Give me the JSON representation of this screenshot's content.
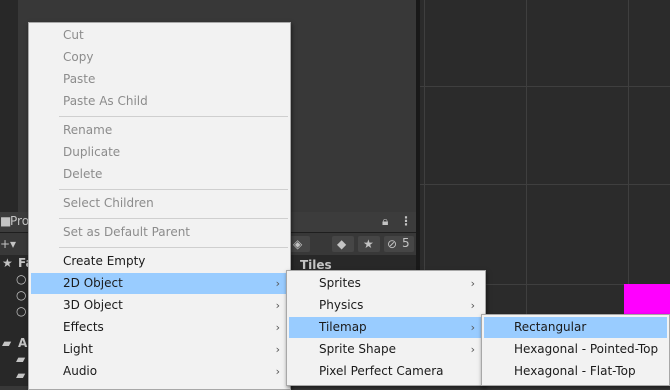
{
  "context_menu": {
    "items": [
      {
        "label": "Cut",
        "enabled": false
      },
      {
        "label": "Copy",
        "enabled": false
      },
      {
        "label": "Paste",
        "enabled": false
      },
      {
        "label": "Paste As Child",
        "enabled": false
      },
      {
        "label": "Rename",
        "enabled": false
      },
      {
        "label": "Duplicate",
        "enabled": false
      },
      {
        "label": "Delete",
        "enabled": false
      },
      {
        "label": "Select Children",
        "enabled": false
      },
      {
        "label": "Set as Default Parent",
        "enabled": false
      },
      {
        "label": "Create Empty",
        "enabled": true
      },
      {
        "label": "2D Object",
        "enabled": true,
        "submenu": true,
        "highlighted": true
      },
      {
        "label": "3D Object",
        "enabled": true,
        "submenu": true
      },
      {
        "label": "Effects",
        "enabled": true,
        "submenu": true
      },
      {
        "label": "Light",
        "enabled": true,
        "submenu": true
      },
      {
        "label": "Audio",
        "enabled": true,
        "submenu": true
      }
    ]
  },
  "submenu_2d_object": {
    "items": [
      {
        "label": "Sprites",
        "submenu": true
      },
      {
        "label": "Physics",
        "submenu": true
      },
      {
        "label": "Tilemap",
        "submenu": true,
        "highlighted": true
      },
      {
        "label": "Sprite Shape",
        "submenu": true
      },
      {
        "label": "Pixel Perfect Camera",
        "submenu": false
      }
    ]
  },
  "submenu_tilemap": {
    "items": [
      {
        "label": "Rectangular",
        "highlighted": true
      },
      {
        "label": "Hexagonal - Pointed-Top"
      },
      {
        "label": "Hexagonal - Flat-Top"
      }
    ]
  },
  "project_panel": {
    "tab_label": "Proj",
    "breadcrumb": "Tiles",
    "hidden_count": "5",
    "favorites_label": "Fa",
    "assets_label": "A"
  },
  "colors": {
    "menu_bg": "#f2f2f2",
    "highlight": "#99ccff",
    "scene_bg": "#2b2b2b",
    "magenta_tile": "#ff00ff"
  },
  "icons": {
    "submenu_arrow": "›",
    "lock": "lock-icon",
    "kebab": "kebab-menu-icon",
    "eye_hidden": "eye-slash-icon",
    "star": "star-icon",
    "tag": "tag-icon",
    "folder": "folder-icon",
    "search": "search-icon"
  }
}
